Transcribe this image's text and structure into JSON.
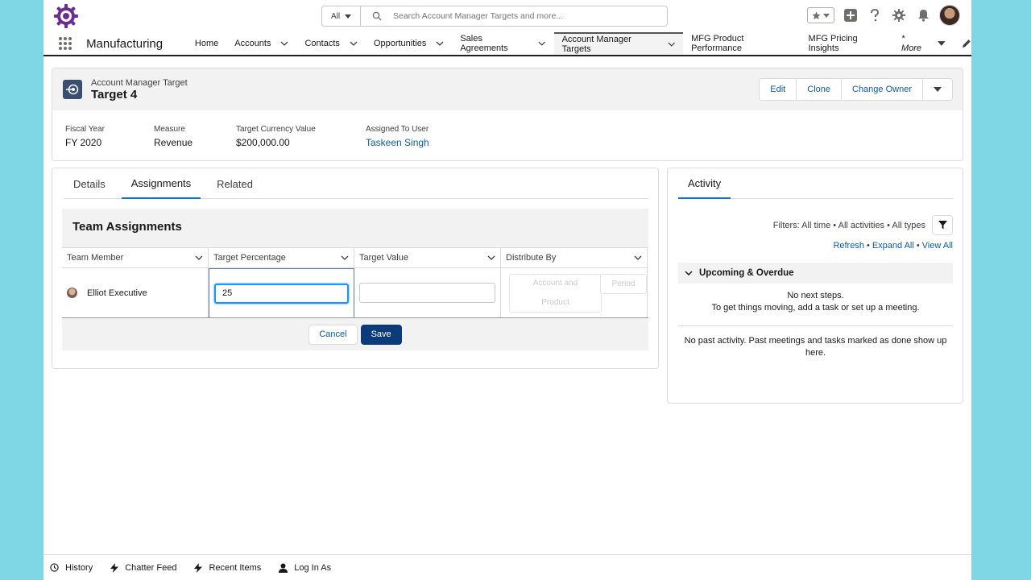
{
  "header": {
    "search_scope": "All",
    "search_placeholder": "Search Account Manager Targets and more..."
  },
  "nav": {
    "app_name": "Manufacturing",
    "items": [
      {
        "label": "Home",
        "has_menu": false
      },
      {
        "label": "Accounts",
        "has_menu": true
      },
      {
        "label": "Contacts",
        "has_menu": true
      },
      {
        "label": "Opportunities",
        "has_menu": true
      },
      {
        "label": "Sales Agreements",
        "has_menu": true
      },
      {
        "label": "Account Manager Targets",
        "has_menu": true,
        "active": true
      },
      {
        "label": "MFG Product Performance",
        "has_menu": false
      },
      {
        "label": "MFG Pricing Insights",
        "has_menu": false
      }
    ],
    "more_label": "* More"
  },
  "record": {
    "object_label": "Account Manager Target",
    "name": "Target 4",
    "actions": [
      "Edit",
      "Clone",
      "Change Owner"
    ],
    "fields": [
      {
        "label": "Fiscal Year",
        "value": "FY 2020"
      },
      {
        "label": "Measure",
        "value": "Revenue"
      },
      {
        "label": "Target Currency Value",
        "value": "$200,000.00"
      },
      {
        "label": "Assigned To User",
        "value": "Taskeen Singh"
      }
    ]
  },
  "tabs": [
    "Details",
    "Assignments",
    "Related"
  ],
  "team": {
    "title": "Team Assignments",
    "columns": [
      "Team Member",
      "Target Percentage",
      "Target Value",
      "Distribute By"
    ],
    "row": {
      "member": "Elliot Executive",
      "target_percentage": "25",
      "target_value": "",
      "distribute_option_1": "Account and Product",
      "distribute_option_2": "Period"
    },
    "cancel_label": "Cancel",
    "save_label": "Save"
  },
  "activity": {
    "tab_label": "Activity",
    "filters_text": "Filters: All time • All activities • All types",
    "refresh": "Refresh",
    "expand_all": "Expand All",
    "view_all": "View All",
    "upcoming_label": "Upcoming & Overdue",
    "no_next_1": "No next steps.",
    "no_next_2": "To get things moving, add a task or set up a meeting.",
    "no_past": "No past activity. Past meetings and tasks marked as done show up here."
  },
  "utility": [
    "History",
    "Chatter Feed",
    "Recent Items",
    "Log In As"
  ],
  "colors": {
    "brand": "#0b3b7a",
    "link": "#0b5cab",
    "tab_active": "#0176d3",
    "logo": "#6b2d8f",
    "backdrop": "#7fd7e6"
  }
}
